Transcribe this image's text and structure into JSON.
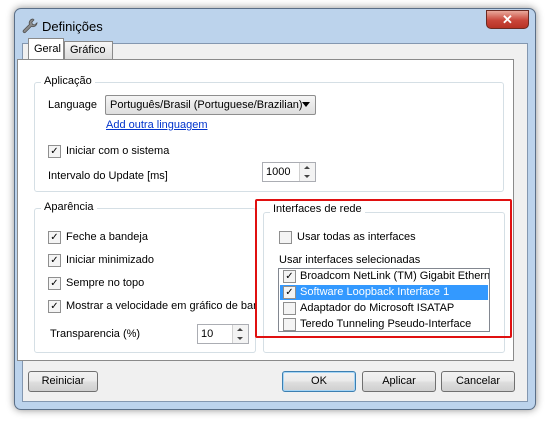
{
  "window": {
    "title": "Definições"
  },
  "tabs": [
    {
      "label": "Geral"
    },
    {
      "label": "Gráfico"
    }
  ],
  "aplicacao": {
    "group_title": "Aplicação",
    "language_label": "Language",
    "language_value": "Português/Brasil (Portuguese/Brazilian)",
    "add_language_link": "Add outra linguagem",
    "start_with_system": {
      "label": "Iniciar com o sistema",
      "checked": true
    },
    "update_interval_label": "Intervalo do Update [ms]",
    "update_interval_value": "1000"
  },
  "aparencia": {
    "group_title": "Aparência",
    "options": [
      {
        "label": "Feche a bandeja",
        "checked": true
      },
      {
        "label": "Iniciar minimizado",
        "checked": true
      },
      {
        "label": "Sempre no topo",
        "checked": true
      },
      {
        "label": "Mostrar a velocidade em gráfico de barra",
        "checked": true
      }
    ],
    "transparency_label": "Transparencia (%)",
    "transparency_value": "10"
  },
  "interfaces": {
    "group_title": "Interfaces de rede",
    "use_all": {
      "label": "Usar todas as interfaces",
      "checked": false
    },
    "selected_label": "Usar interfaces selecionadas",
    "items": [
      {
        "label": "Broadcom NetLink (TM) Gigabit Ethernet",
        "checked": true,
        "selected": false
      },
      {
        "label": "Software Loopback Interface 1",
        "checked": true,
        "selected": true
      },
      {
        "label": "Adaptador do Microsoft ISATAP",
        "checked": false,
        "selected": false
      },
      {
        "label": "Teredo Tunneling Pseudo-Interface",
        "checked": false,
        "selected": false
      }
    ]
  },
  "buttons": {
    "reset": "Reiniciar",
    "ok": "OK",
    "apply": "Aplicar",
    "cancel": "Cancelar"
  },
  "colors": {
    "highlight_border": "#e01010",
    "selection": "#3399ff",
    "link": "#0033cc"
  }
}
